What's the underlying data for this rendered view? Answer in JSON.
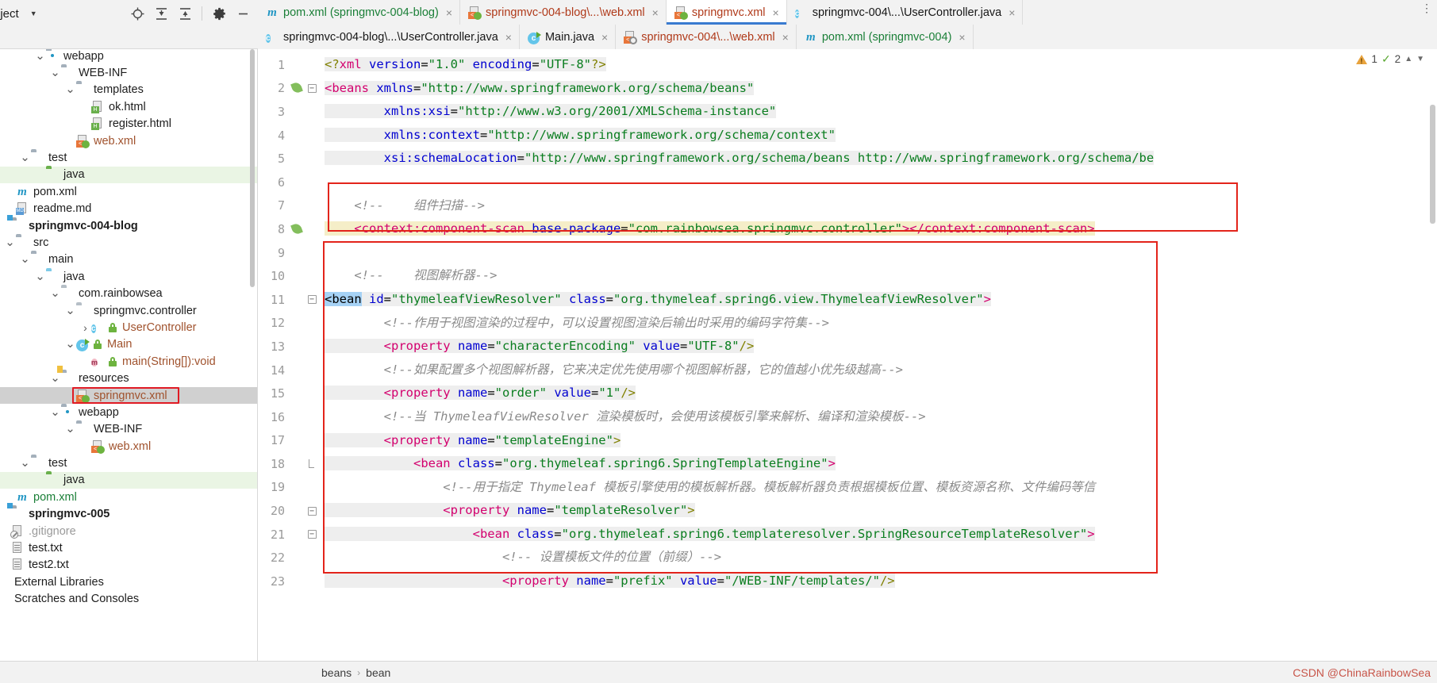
{
  "project_panel": {
    "title": "oject",
    "caret_icon": "chevron-down-icon",
    "tools": [
      {
        "name": "locate-icon",
        "glyph": "⊕"
      },
      {
        "name": "expand-all-icon",
        "glyph": "↧"
      },
      {
        "name": "collapse-all-icon",
        "glyph": "↥"
      },
      {
        "name": "settings-gear-icon",
        "glyph": "⚙"
      },
      {
        "name": "hide-icon",
        "glyph": "—"
      }
    ]
  },
  "tree": {
    "items": [
      {
        "label": "webapp",
        "indent": 2,
        "arrow": "v",
        "icon": "folder-webapp-icon",
        "color": "dark"
      },
      {
        "label": "WEB-INF",
        "indent": 3,
        "arrow": "v",
        "icon": "folder-icon",
        "color": "dark"
      },
      {
        "label": "templates",
        "indent": 4,
        "arrow": "v",
        "icon": "folder-icon",
        "color": "dark"
      },
      {
        "label": "ok.html",
        "indent": 5,
        "arrow": "",
        "icon": "html-file-icon",
        "color": "dark"
      },
      {
        "label": "register.html",
        "indent": 5,
        "arrow": "",
        "icon": "html-file-icon",
        "color": "dark"
      },
      {
        "label": "web.xml",
        "indent": 4,
        "arrow": "",
        "icon": "xml-spring-file-icon",
        "color": "brown"
      },
      {
        "label": "test",
        "indent": 1,
        "arrow": "v",
        "icon": "folder-icon",
        "color": "dark"
      },
      {
        "label": "java",
        "indent": 2,
        "arrow": "",
        "icon": "folder-test-icon",
        "color": "dark",
        "rowbg": "green"
      },
      {
        "label": "pom.xml",
        "indent": 0,
        "arrow": "",
        "icon": "maven-icon",
        "color": "dark"
      },
      {
        "label": "readme.md",
        "indent": 0,
        "arrow": "",
        "icon": "md-file-icon",
        "color": "dark"
      },
      {
        "label": "springmvc-004-blog",
        "indent": -1,
        "arrow": "",
        "icon": "module-icon",
        "color": "dark",
        "bold": true
      },
      {
        "label": "src",
        "indent": 0,
        "arrow": "v",
        "icon": "folder-icon",
        "color": "dark"
      },
      {
        "label": "main",
        "indent": 1,
        "arrow": "v",
        "icon": "folder-icon",
        "color": "dark"
      },
      {
        "label": "java",
        "indent": 2,
        "arrow": "v",
        "icon": "folder-src-icon",
        "color": "dark"
      },
      {
        "label": "com.rainbowsea",
        "indent": 3,
        "arrow": "v",
        "icon": "package-icon",
        "color": "dark"
      },
      {
        "label": "springmvc.controller",
        "indent": 4,
        "arrow": "v",
        "icon": "package-icon",
        "color": "dark"
      },
      {
        "label": "UserController",
        "indent": 5,
        "arrow": ">",
        "icon": "java-class-icon",
        "color": "brown",
        "lock": true
      },
      {
        "label": "Main",
        "indent": 4,
        "arrow": "v",
        "icon": "java-class-runnable-icon",
        "color": "brown",
        "lock": true
      },
      {
        "label": "main(String[]):void",
        "indent": 5,
        "arrow": "",
        "icon": "java-method-icon",
        "color": "brown",
        "lock": true
      },
      {
        "label": "resources",
        "indent": 3,
        "arrow": "v",
        "icon": "folder-resources-icon",
        "color": "dark"
      },
      {
        "label": "springmvc.xml",
        "indent": 4,
        "arrow": "",
        "icon": "xml-spring-file-icon",
        "color": "brown",
        "rowbg": "gray",
        "selected": true
      },
      {
        "label": "webapp",
        "indent": 3,
        "arrow": "v",
        "icon": "folder-webapp-icon",
        "color": "dark"
      },
      {
        "label": "WEB-INF",
        "indent": 4,
        "arrow": "v",
        "icon": "folder-icon",
        "color": "dark"
      },
      {
        "label": "web.xml",
        "indent": 5,
        "arrow": "",
        "icon": "xml-spring-file-icon",
        "color": "brown"
      },
      {
        "label": "test",
        "indent": 1,
        "arrow": "v",
        "icon": "folder-icon",
        "color": "dark"
      },
      {
        "label": "java",
        "indent": 2,
        "arrow": "",
        "icon": "folder-test-icon",
        "color": "dark",
        "rowbg": "green"
      },
      {
        "label": "pom.xml",
        "indent": 0,
        "arrow": "",
        "icon": "maven-icon",
        "color": "green"
      },
      {
        "label": "springmvc-005",
        "indent": -1,
        "arrow": "",
        "icon": "module-icon",
        "color": "dark",
        "bold": true
      },
      {
        "label": ".gitignore",
        "indent": -1,
        "arrow": "",
        "icon": "gitignore-icon",
        "color": "gray"
      },
      {
        "label": "test.txt",
        "indent": -1,
        "arrow": "",
        "icon": "text-file-icon",
        "color": "dark"
      },
      {
        "label": "test2.txt",
        "indent": -1,
        "arrow": "",
        "icon": "text-file-icon",
        "color": "dark"
      },
      {
        "label": "External Libraries",
        "indent": -2,
        "arrow": "",
        "icon": "none",
        "color": "dark"
      },
      {
        "label": "Scratches and Consoles",
        "indent": -2,
        "arrow": "",
        "icon": "none",
        "color": "dark"
      }
    ]
  },
  "tabs": {
    "row1": [
      {
        "label": "pom.xml (springmvc-004-blog)",
        "icon": "maven-icon",
        "color": "green",
        "active": false,
        "closable": true
      },
      {
        "label": "springmvc-004-blog\\...\\web.xml",
        "icon": "xml-spring-file-icon",
        "color": "red",
        "active": false,
        "closable": true
      },
      {
        "label": "springmvc.xml",
        "icon": "xml-spring-file-icon",
        "color": "red",
        "active": true,
        "closable": true
      },
      {
        "label": "springmvc-004\\...\\UserController.java",
        "icon": "java-class-icon",
        "color": "dark",
        "active": false,
        "closable": true
      }
    ],
    "row2": [
      {
        "label": "springmvc-004-blog\\...\\UserController.java",
        "icon": "java-class-icon",
        "color": "dark",
        "active": false,
        "closable": true
      },
      {
        "label": "Main.java",
        "icon": "java-class-runnable-icon",
        "color": "dark",
        "active": false,
        "closable": true
      },
      {
        "label": "springmvc-004\\...\\web.xml",
        "icon": "xml-gear-file-icon",
        "color": "red",
        "active": false,
        "closable": true
      },
      {
        "label": "pom.xml (springmvc-004)",
        "icon": "maven-icon",
        "color": "green",
        "active": false,
        "closable": true
      }
    ]
  },
  "editor": {
    "line_numbers": [
      "1",
      "2",
      "3",
      "4",
      "5",
      "6",
      "7",
      "8",
      "9",
      "10",
      "11",
      "12",
      "13",
      "14",
      "15",
      "16",
      "17",
      "18",
      "19",
      "20",
      "21",
      "22",
      "23"
    ],
    "lines": [
      {
        "n": 1,
        "tokens": [
          {
            "t": "<?",
            "c": "tk-pi"
          },
          {
            "t": "xml",
            "c": "tk-tagname"
          },
          {
            "t": " version",
            "c": "tk-attr"
          },
          {
            "t": "=",
            "c": "tk-plain"
          },
          {
            "t": "\"1.0\"",
            "c": "tk-val"
          },
          {
            "t": " encoding",
            "c": "tk-attr"
          },
          {
            "t": "=",
            "c": "tk-plain"
          },
          {
            "t": "\"UTF-8\"",
            "c": "tk-val"
          },
          {
            "t": "?>",
            "c": "tk-pi"
          }
        ],
        "hl": true
      },
      {
        "n": 2,
        "tokens": [
          {
            "t": "<beans",
            "c": "tk-tagname"
          },
          {
            "t": " xmlns",
            "c": "tk-attr"
          },
          {
            "t": "=",
            "c": "tk-plain"
          },
          {
            "t": "\"http://www.springframework.org/schema/beans\"",
            "c": "tk-val"
          }
        ],
        "hl": true
      },
      {
        "n": 3,
        "tokens": [
          {
            "t": "        xmlns:xsi",
            "c": "tk-attr"
          },
          {
            "t": "=",
            "c": "tk-plain"
          },
          {
            "t": "\"http://www.w3.org/2001/XMLSchema-instance\"",
            "c": "tk-val"
          }
        ],
        "hl": true
      },
      {
        "n": 4,
        "tokens": [
          {
            "t": "        xmlns:context",
            "c": "tk-attr"
          },
          {
            "t": "=",
            "c": "tk-plain"
          },
          {
            "t": "\"http://www.springframework.org/schema/context\"",
            "c": "tk-val"
          }
        ],
        "hl": true
      },
      {
        "n": 5,
        "tokens": [
          {
            "t": "        xsi:schemaLocation",
            "c": "tk-attr"
          },
          {
            "t": "=",
            "c": "tk-plain"
          },
          {
            "t": "\"http://www.springframework.org/schema/beans http://www.springframework.org/schema/be",
            "c": "tk-val"
          }
        ],
        "hl": true
      },
      {
        "n": 6,
        "tokens": [],
        "hl": false
      },
      {
        "n": 7,
        "tokens": [
          {
            "t": "    <!--    组件扫描-->",
            "c": "tk-cm"
          }
        ],
        "hl": false
      },
      {
        "n": 8,
        "tokens": [
          {
            "t": "    <context:component-scan",
            "c": "tk-tagname"
          },
          {
            "t": " base-package",
            "c": "tk-attr"
          },
          {
            "t": "=",
            "c": "tk-plain"
          },
          {
            "t": "\"com.rainbowsea.springmvc.controller\"",
            "c": "tk-val"
          },
          {
            "t": "></context:component-scan>",
            "c": "tk-tagname"
          }
        ],
        "hl": true,
        "hlcolor": "#f5eec8"
      },
      {
        "n": 9,
        "tokens": [],
        "hl": false
      },
      {
        "n": 10,
        "tokens": [
          {
            "t": "    <!--    视图解析器-->",
            "c": "tk-cm"
          }
        ],
        "hl": false
      },
      {
        "n": 11,
        "tokens": [
          {
            "t": "<bean",
            "c": "sel-bean"
          },
          {
            "t": " id",
            "c": "tk-attr"
          },
          {
            "t": "=",
            "c": "tk-plain"
          },
          {
            "t": "\"thymeleafViewResolver\"",
            "c": "tk-val"
          },
          {
            "t": " class",
            "c": "tk-attr"
          },
          {
            "t": "=",
            "c": "tk-plain"
          },
          {
            "t": "\"org.thymeleaf.spring6.view.ThymeleafViewResolver\"",
            "c": "tk-val"
          },
          {
            "t": ">",
            "c": "tk-tagname"
          }
        ],
        "hl": true
      },
      {
        "n": 12,
        "tokens": [
          {
            "t": "        <!--作用于视图渲染的过程中，可以设置视图渲染后输出时采用的编码字符集-->",
            "c": "tk-cm"
          }
        ],
        "hl": false
      },
      {
        "n": 13,
        "tokens": [
          {
            "t": "        <property",
            "c": "tk-tagname"
          },
          {
            "t": " name",
            "c": "tk-attr"
          },
          {
            "t": "=",
            "c": "tk-plain"
          },
          {
            "t": "\"characterEncoding\"",
            "c": "tk-val"
          },
          {
            "t": " value",
            "c": "tk-attr"
          },
          {
            "t": "=",
            "c": "tk-plain"
          },
          {
            "t": "\"UTF-8\"",
            "c": "tk-val"
          },
          {
            "t": "/>",
            "c": "tk-punct"
          }
        ],
        "hl": true
      },
      {
        "n": 14,
        "tokens": [
          {
            "t": "        <!--如果配置多个视图解析器，它来决定优先使用哪个视图解析器，它的值越小优先级越高-->",
            "c": "tk-cm"
          }
        ],
        "hl": false
      },
      {
        "n": 15,
        "tokens": [
          {
            "t": "        <property",
            "c": "tk-tagname"
          },
          {
            "t": " name",
            "c": "tk-attr"
          },
          {
            "t": "=",
            "c": "tk-plain"
          },
          {
            "t": "\"order\"",
            "c": "tk-val"
          },
          {
            "t": " value",
            "c": "tk-attr"
          },
          {
            "t": "=",
            "c": "tk-plain"
          },
          {
            "t": "\"1\"",
            "c": "tk-val"
          },
          {
            "t": "/>",
            "c": "tk-punct"
          }
        ],
        "hl": true
      },
      {
        "n": 16,
        "tokens": [
          {
            "t": "        <!--当 ThymeleafViewResolver 渲染模板时，会使用该模板引擎来解析、编译和渲染模板-->",
            "c": "tk-cm"
          }
        ],
        "hl": false
      },
      {
        "n": 17,
        "tokens": [
          {
            "t": "        <property",
            "c": "tk-tagname"
          },
          {
            "t": " name",
            "c": "tk-attr"
          },
          {
            "t": "=",
            "c": "tk-plain"
          },
          {
            "t": "\"templateEngine\"",
            "c": "tk-val"
          },
          {
            "t": ">",
            "c": "tk-punct"
          }
        ],
        "hl": true
      },
      {
        "n": 18,
        "tokens": [
          {
            "t": "            <bean",
            "c": "tk-tagname"
          },
          {
            "t": " class",
            "c": "tk-attr"
          },
          {
            "t": "=",
            "c": "tk-plain"
          },
          {
            "t": "\"org.thymeleaf.spring6.SpringTemplateEngine\"",
            "c": "tk-val"
          },
          {
            "t": ">",
            "c": "tk-tagname"
          }
        ],
        "hl": true
      },
      {
        "n": 19,
        "tokens": [
          {
            "t": "                <!--用于指定 Thymeleaf 模板引擎使用的模板解析器。模板解析器负责根据模板位置、模板资源名称、文件编码等信",
            "c": "tk-cm"
          }
        ],
        "hl": false
      },
      {
        "n": 20,
        "tokens": [
          {
            "t": "                <property",
            "c": "tk-tagname"
          },
          {
            "t": " name",
            "c": "tk-attr"
          },
          {
            "t": "=",
            "c": "tk-plain"
          },
          {
            "t": "\"templateResolver\"",
            "c": "tk-val"
          },
          {
            "t": ">",
            "c": "tk-punct"
          }
        ],
        "hl": true
      },
      {
        "n": 21,
        "tokens": [
          {
            "t": "                    <bean",
            "c": "tk-tagname"
          },
          {
            "t": " class",
            "c": "tk-attr"
          },
          {
            "t": "=",
            "c": "tk-plain"
          },
          {
            "t": "\"org.thymeleaf.spring6.templateresolver.SpringResourceTemplateResolver\"",
            "c": "tk-val"
          },
          {
            "t": ">",
            "c": "tk-tagname"
          }
        ],
        "hl": true
      },
      {
        "n": 22,
        "tokens": [
          {
            "t": "                        <!-- 设置模板文件的位置（前缀）-->",
            "c": "tk-cm"
          }
        ],
        "hl": false
      },
      {
        "n": 23,
        "tokens": [
          {
            "t": "                        <property",
            "c": "tk-tagname"
          },
          {
            "t": " name",
            "c": "tk-attr"
          },
          {
            "t": "=",
            "c": "tk-plain"
          },
          {
            "t": "\"prefix\"",
            "c": "tk-val"
          },
          {
            "t": " value",
            "c": "tk-attr"
          },
          {
            "t": "=",
            "c": "tk-plain"
          },
          {
            "t": "\"/WEB-INF/templates/\"",
            "c": "tk-val"
          },
          {
            "t": "/>",
            "c": "tk-punct"
          }
        ],
        "hl": true
      }
    ],
    "inspection": {
      "warning_count": "1",
      "check_count": "2",
      "warning_icon": "warning-triangle-icon",
      "check_icon": "check-mark-icon",
      "up_icon": "chevron-up-icon",
      "down_icon": "chevron-down-icon"
    }
  },
  "statusbar": {
    "breadcrumb": [
      "beans",
      "bean"
    ],
    "separator": "›",
    "watermark": "CSDN @ChinaRainbowSea"
  }
}
